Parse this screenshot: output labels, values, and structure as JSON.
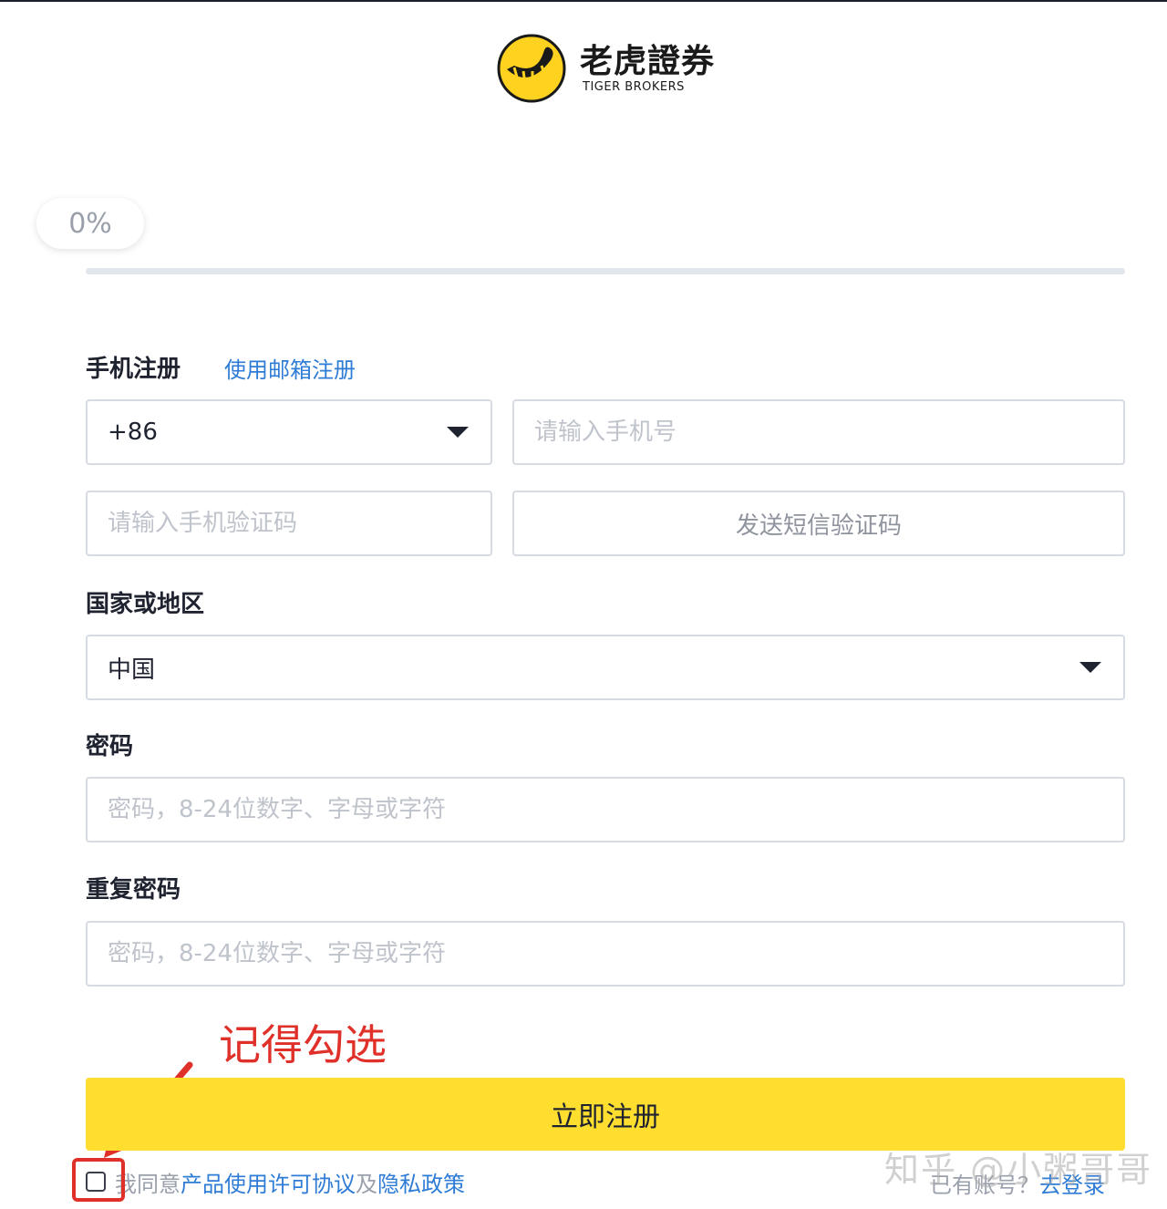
{
  "brand": {
    "name_cn": "老虎證券",
    "name_en": "TIGER BROKERS",
    "brand_color": "#ffde2f"
  },
  "progress": {
    "label": "0%",
    "value": 0
  },
  "phone_signup": {
    "title": "手机注册",
    "alt_link": "使用邮箱注册",
    "country_code": "+86",
    "phone_placeholder": "请输入手机号",
    "sms_code_placeholder": "请输入手机验证码",
    "send_code_label": "发送短信验证码"
  },
  "region": {
    "label": "国家或地区",
    "value": "中国"
  },
  "password": {
    "label": "密码",
    "placeholder": "密码，8-24位数字、字母或字符"
  },
  "repeat_password": {
    "label": "重复密码",
    "placeholder": "密码，8-24位数字、字母或字符"
  },
  "annotation": {
    "text": "记得勾选",
    "color": "#e0302a"
  },
  "register_button": "立即注册",
  "agreement": {
    "prefix": "我同意",
    "link1": "产品使用许可协议",
    "middle": "及",
    "link2": "隐私政策"
  },
  "login": {
    "question": "已有账号？",
    "link": "去登录"
  },
  "watermark": "知乎 @小粥哥哥"
}
